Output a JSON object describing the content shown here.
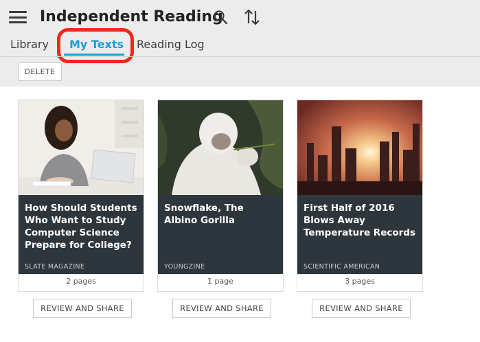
{
  "header": {
    "title": "Independent Reading",
    "menu_icon": "hamburger-menu-icon",
    "search_icon": "search-icon",
    "sort_icon": "sort-arrows-icon"
  },
  "tabs": [
    {
      "label": "Library",
      "active": false
    },
    {
      "label": "My Texts",
      "active": true
    },
    {
      "label": "Reading Log",
      "active": false
    }
  ],
  "toolbar": {
    "delete_label": "DELETE"
  },
  "colors": {
    "accent": "#1a9fdc",
    "annotation": "#f0281b",
    "card_body": "#2e363d",
    "header_bg": "#ececec"
  },
  "cards": [
    {
      "title": "How Should Students Who Want to Study Computer Science Prepare for College?",
      "source": "SLATE MAGAZINE",
      "pages": "2 pages",
      "action": "REVIEW AND SHARE"
    },
    {
      "title": "Snowflake, The Albino Gorilla",
      "source": "YOUNGZINE",
      "pages": "1 page",
      "action": "REVIEW AND SHARE"
    },
    {
      "title": "First Half of 2016 Blows Away Temperature Records",
      "source": "SCIENTIFIC AMERICAN",
      "pages": "3 pages",
      "action": "REVIEW AND SHARE"
    }
  ]
}
